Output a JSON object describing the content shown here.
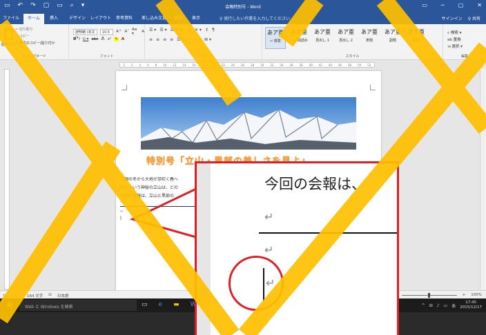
{
  "title_bar": {
    "qat_icons": [
      "save-icon",
      "undo-icon",
      "redo-icon",
      "new-icon",
      "open-icon",
      "print-preview-icon",
      "customize-icon"
    ],
    "qat_glyphs": [
      "▭",
      "↶",
      "↷",
      "▢",
      "▭",
      "⌕",
      "▾"
    ],
    "doc_title": "会報特別号 - Word",
    "window_controls": [
      "▭",
      "─",
      "▢",
      "✕"
    ]
  },
  "ribbon_tabs": [
    "ファイル",
    "ホーム",
    "挿入",
    "デザイン",
    "レイアウト",
    "参考資料",
    "差し込み文書",
    "校閲",
    "表示"
  ],
  "active_tab": "ホーム",
  "tell_me": "♀ 実行したい作業を入力してください...",
  "account": {
    "signin": "サインイン",
    "share": "♀ 共有"
  },
  "clipboard": {
    "paste": "貼り付け",
    "cut": "✂ 切り取り",
    "copy": "⎘ コピー",
    "format_painter": "✎ 書式のコピー/貼り付け",
    "group_label": "クリップボード"
  },
  "font": {
    "font_name": "游明朝 (本文(▾",
    "font_size": "10.5 ▾",
    "row1_rest": [
      "A^",
      "Aˇ",
      "Aa ▾",
      "A"
    ],
    "row2": [
      "B",
      "I",
      "U ▾",
      "abc",
      "x₂",
      "x²"
    ],
    "group_label": "フォント"
  },
  "paragraph": {
    "row1": [
      "☰ ▾",
      "☰ ▾",
      "☰ ▾",
      "⇤",
      "⇥",
      "✕ ▾",
      "↕",
      "¶"
    ],
    "row2": [
      "≡",
      "≡",
      "≡",
      "≡",
      "☰",
      "↕ ▾",
      "◇ ▾",
      "⊞ ▾"
    ],
    "group_label": "段落"
  },
  "styles": {
    "items": [
      {
        "sample": "あア亜",
        "label": "↵ 標準"
      },
      {
        "sample": "あア亜",
        "label": "↵ 行間詰め"
      },
      {
        "sample": "あア亜",
        "label": "見出し 1"
      },
      {
        "sample": "あア亜",
        "label": "見出し 2"
      },
      {
        "sample": "あア亜",
        "label": "表題"
      },
      {
        "sample": "あア亜",
        "label": "副題"
      },
      {
        "sample": "あア亜",
        "label": "斜体"
      }
    ],
    "group_label": "スタイル"
  },
  "editing": {
    "find": "⌕ 検索 ▾",
    "replace": "ab 置換",
    "select": "⇲ 選択 ▾",
    "group_label": "編集"
  },
  "ruler": {
    "ticks": [
      "2",
      "2",
      "4",
      "6",
      "8",
      "10",
      "12",
      "14",
      "16",
      "18",
      "20",
      "22",
      "24",
      "26",
      "28",
      "30",
      "32",
      "34",
      "36",
      "38",
      "40",
      "42",
      "44",
      "46",
      "48",
      "50",
      "52"
    ]
  },
  "document": {
    "heading": "特別号「立山・黒部の美しさを見よ」",
    "lines": [
      "白銀の冬から大地が芽吹く春へ",
      "宿るという神秘の立山は、どの",
      "今回の会報は、立山と黒部の"
    ]
  },
  "status_bar": {
    "page": "1/1 ページ",
    "words": "164 文字",
    "proof_icon": "⊡",
    "language": "日本語",
    "views": [
      "▥",
      "▤",
      "⊟"
    ],
    "zoom_minus": "−",
    "zoom_plus": "+",
    "zoom_level": "100%"
  },
  "taskbar": {
    "start": "⊞",
    "search": "Web と Windows を検索",
    "apps": [
      "▭",
      "e",
      "▬",
      "W"
    ],
    "tray_icons": [
      "^",
      "⊟",
      "♪",
      "▭",
      "あ"
    ],
    "time": "17:45",
    "date": "2015/12/17"
  },
  "zoom_callout": {
    "text": "今回の会報は、",
    "return_mark": "↵"
  },
  "colors": {
    "word_blue": "#2b579a",
    "callout_red": "#e21d24",
    "highlight_yellow": "#ffc000",
    "heading_orange": "#f7a03a"
  }
}
